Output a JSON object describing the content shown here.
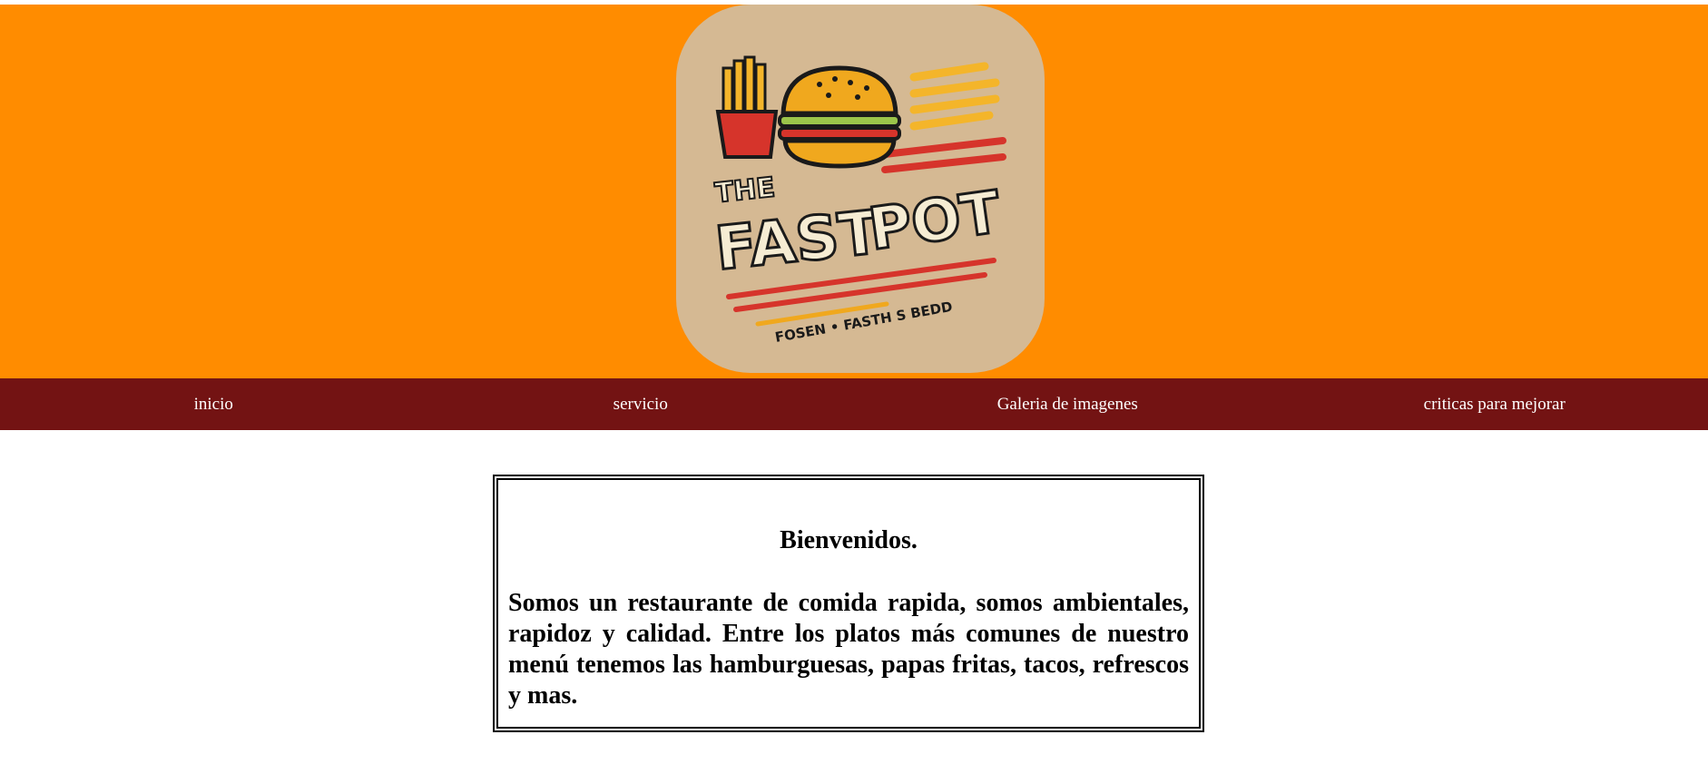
{
  "header": {
    "background": "#ff8c00",
    "logo": {
      "alt": "The Fast Pot logo",
      "line1": "THE",
      "line2": "FAST",
      "line3": "POT",
      "tagline": "FOSEN • FASTH S BEDD"
    }
  },
  "nav": {
    "background": "#731313",
    "items": [
      {
        "label": "inicio"
      },
      {
        "label": "servicio"
      },
      {
        "label": "Galeria de imagenes"
      },
      {
        "label": "criticas para mejorar"
      }
    ]
  },
  "main": {
    "title": "Bienvenidos.",
    "body": "Somos un restaurante de comida rapida, somos ambientales, rapidoz y calidad. Entre los platos más comunes de nuestro menú tenemos las hamburguesas, papas fritas, tacos, refrescos y mas."
  }
}
